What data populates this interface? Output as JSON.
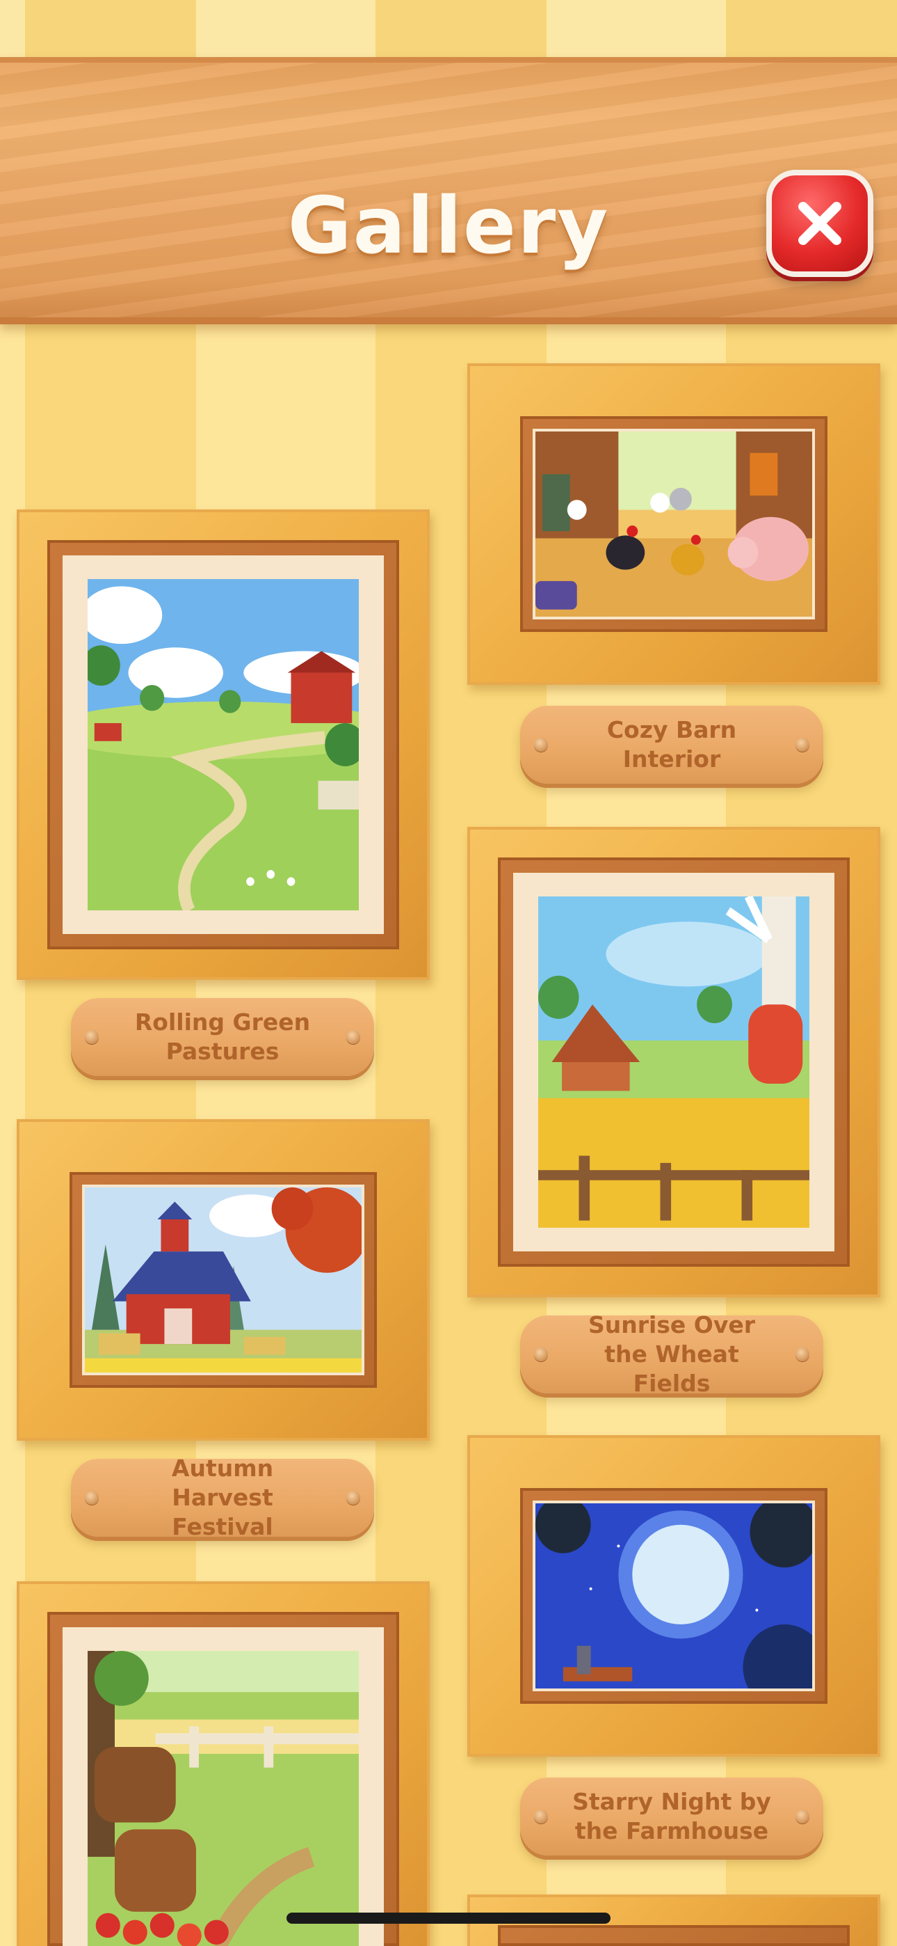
{
  "screen": {
    "title": "Gallery",
    "close_icon": "close-x-icon"
  },
  "paintings": [
    {
      "id": "cozy-barn-interior",
      "title": "Cozy Barn Interior",
      "scene": "barn-interior-chickens-pig"
    },
    {
      "id": "rolling-green-pastures",
      "title": "Rolling Green Pastures",
      "scene": "green-hills-path-barn"
    },
    {
      "id": "sunrise-wheat-fields",
      "title": "Sunrise Over the Wheat Fields",
      "scene": "wheat-field-windmill"
    },
    {
      "id": "autumn-harvest-festival",
      "title": "Autumn Harvest Festival",
      "scene": "red-barn-hay-bales"
    },
    {
      "id": "starry-night-farmhouse",
      "title": "Starry Night by the Farmhouse",
      "scene": "moon-night-sky"
    },
    {
      "id": "orchard",
      "title": "",
      "scene": "barrels-apples-fence"
    }
  ],
  "colors": {
    "header_wood": "#eca866",
    "frame_gold": "#f1b24a",
    "plaque": "#eaa865",
    "plaque_text": "#b0642a",
    "close_red": "#e52a2a"
  }
}
